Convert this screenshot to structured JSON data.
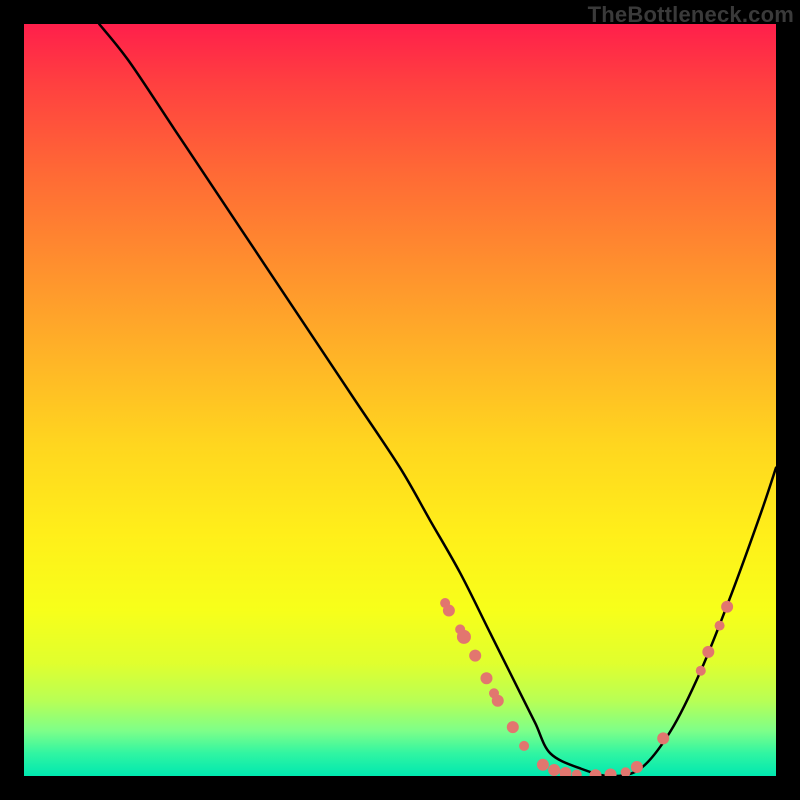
{
  "watermark": "TheBottleneck.com",
  "chart_data": {
    "type": "line",
    "title": "",
    "xlabel": "",
    "ylabel": "",
    "xlim": [
      0,
      100
    ],
    "ylim": [
      0,
      100
    ],
    "series": [
      {
        "name": "curve",
        "x": [
          10,
          14,
          20,
          26,
          32,
          38,
          44,
          50,
          54,
          58,
          62,
          66,
          68,
          70,
          74,
          78,
          82,
          86,
          90,
          94,
          98,
          100
        ],
        "values": [
          100,
          95,
          86,
          77,
          68,
          59,
          50,
          41,
          34,
          27,
          19,
          11,
          7,
          3,
          1,
          0,
          1,
          6,
          14,
          24,
          35,
          41
        ]
      }
    ],
    "markers": [
      {
        "x": 56.0,
        "y": 23.0,
        "r": 5
      },
      {
        "x": 56.5,
        "y": 22.0,
        "r": 6
      },
      {
        "x": 58.0,
        "y": 19.5,
        "r": 5
      },
      {
        "x": 58.5,
        "y": 18.5,
        "r": 7
      },
      {
        "x": 60.0,
        "y": 16.0,
        "r": 6
      },
      {
        "x": 61.5,
        "y": 13.0,
        "r": 6
      },
      {
        "x": 62.5,
        "y": 11.0,
        "r": 5
      },
      {
        "x": 63.0,
        "y": 10.0,
        "r": 6
      },
      {
        "x": 65.0,
        "y": 6.5,
        "r": 6
      },
      {
        "x": 66.5,
        "y": 4.0,
        "r": 5
      },
      {
        "x": 69.0,
        "y": 1.5,
        "r": 6
      },
      {
        "x": 70.5,
        "y": 0.8,
        "r": 6
      },
      {
        "x": 72.0,
        "y": 0.4,
        "r": 6
      },
      {
        "x": 73.5,
        "y": 0.2,
        "r": 5
      },
      {
        "x": 76.0,
        "y": 0.1,
        "r": 6
      },
      {
        "x": 78.0,
        "y": 0.2,
        "r": 6
      },
      {
        "x": 80.0,
        "y": 0.5,
        "r": 5
      },
      {
        "x": 81.5,
        "y": 1.2,
        "r": 6
      },
      {
        "x": 85.0,
        "y": 5.0,
        "r": 6
      },
      {
        "x": 90.0,
        "y": 14.0,
        "r": 5
      },
      {
        "x": 91.0,
        "y": 16.5,
        "r": 6
      },
      {
        "x": 92.5,
        "y": 20.0,
        "r": 5
      },
      {
        "x": 93.5,
        "y": 22.5,
        "r": 6
      }
    ],
    "marker_color": "#e2766f",
    "curve_color": "#000000"
  }
}
